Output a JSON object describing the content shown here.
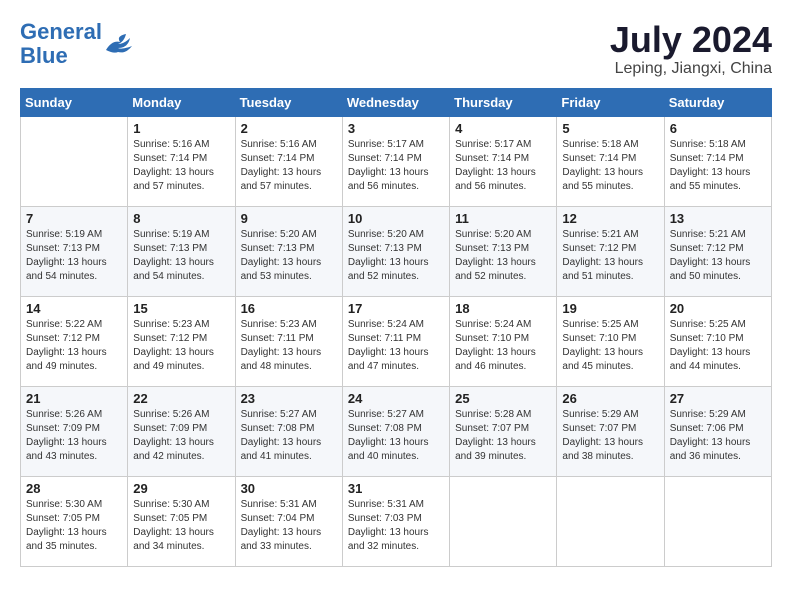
{
  "header": {
    "logo_line1": "General",
    "logo_line2": "Blue",
    "month_year": "July 2024",
    "location": "Leping, Jiangxi, China"
  },
  "weekdays": [
    "Sunday",
    "Monday",
    "Tuesday",
    "Wednesday",
    "Thursday",
    "Friday",
    "Saturday"
  ],
  "weeks": [
    [
      {
        "day": "",
        "info": ""
      },
      {
        "day": "1",
        "info": "Sunrise: 5:16 AM\nSunset: 7:14 PM\nDaylight: 13 hours\nand 57 minutes."
      },
      {
        "day": "2",
        "info": "Sunrise: 5:16 AM\nSunset: 7:14 PM\nDaylight: 13 hours\nand 57 minutes."
      },
      {
        "day": "3",
        "info": "Sunrise: 5:17 AM\nSunset: 7:14 PM\nDaylight: 13 hours\nand 56 minutes."
      },
      {
        "day": "4",
        "info": "Sunrise: 5:17 AM\nSunset: 7:14 PM\nDaylight: 13 hours\nand 56 minutes."
      },
      {
        "day": "5",
        "info": "Sunrise: 5:18 AM\nSunset: 7:14 PM\nDaylight: 13 hours\nand 55 minutes."
      },
      {
        "day": "6",
        "info": "Sunrise: 5:18 AM\nSunset: 7:14 PM\nDaylight: 13 hours\nand 55 minutes."
      }
    ],
    [
      {
        "day": "7",
        "info": "Sunrise: 5:19 AM\nSunset: 7:13 PM\nDaylight: 13 hours\nand 54 minutes."
      },
      {
        "day": "8",
        "info": "Sunrise: 5:19 AM\nSunset: 7:13 PM\nDaylight: 13 hours\nand 54 minutes."
      },
      {
        "day": "9",
        "info": "Sunrise: 5:20 AM\nSunset: 7:13 PM\nDaylight: 13 hours\nand 53 minutes."
      },
      {
        "day": "10",
        "info": "Sunrise: 5:20 AM\nSunset: 7:13 PM\nDaylight: 13 hours\nand 52 minutes."
      },
      {
        "day": "11",
        "info": "Sunrise: 5:20 AM\nSunset: 7:13 PM\nDaylight: 13 hours\nand 52 minutes."
      },
      {
        "day": "12",
        "info": "Sunrise: 5:21 AM\nSunset: 7:12 PM\nDaylight: 13 hours\nand 51 minutes."
      },
      {
        "day": "13",
        "info": "Sunrise: 5:21 AM\nSunset: 7:12 PM\nDaylight: 13 hours\nand 50 minutes."
      }
    ],
    [
      {
        "day": "14",
        "info": "Sunrise: 5:22 AM\nSunset: 7:12 PM\nDaylight: 13 hours\nand 49 minutes."
      },
      {
        "day": "15",
        "info": "Sunrise: 5:23 AM\nSunset: 7:12 PM\nDaylight: 13 hours\nand 49 minutes."
      },
      {
        "day": "16",
        "info": "Sunrise: 5:23 AM\nSunset: 7:11 PM\nDaylight: 13 hours\nand 48 minutes."
      },
      {
        "day": "17",
        "info": "Sunrise: 5:24 AM\nSunset: 7:11 PM\nDaylight: 13 hours\nand 47 minutes."
      },
      {
        "day": "18",
        "info": "Sunrise: 5:24 AM\nSunset: 7:10 PM\nDaylight: 13 hours\nand 46 minutes."
      },
      {
        "day": "19",
        "info": "Sunrise: 5:25 AM\nSunset: 7:10 PM\nDaylight: 13 hours\nand 45 minutes."
      },
      {
        "day": "20",
        "info": "Sunrise: 5:25 AM\nSunset: 7:10 PM\nDaylight: 13 hours\nand 44 minutes."
      }
    ],
    [
      {
        "day": "21",
        "info": "Sunrise: 5:26 AM\nSunset: 7:09 PM\nDaylight: 13 hours\nand 43 minutes."
      },
      {
        "day": "22",
        "info": "Sunrise: 5:26 AM\nSunset: 7:09 PM\nDaylight: 13 hours\nand 42 minutes."
      },
      {
        "day": "23",
        "info": "Sunrise: 5:27 AM\nSunset: 7:08 PM\nDaylight: 13 hours\nand 41 minutes."
      },
      {
        "day": "24",
        "info": "Sunrise: 5:27 AM\nSunset: 7:08 PM\nDaylight: 13 hours\nand 40 minutes."
      },
      {
        "day": "25",
        "info": "Sunrise: 5:28 AM\nSunset: 7:07 PM\nDaylight: 13 hours\nand 39 minutes."
      },
      {
        "day": "26",
        "info": "Sunrise: 5:29 AM\nSunset: 7:07 PM\nDaylight: 13 hours\nand 38 minutes."
      },
      {
        "day": "27",
        "info": "Sunrise: 5:29 AM\nSunset: 7:06 PM\nDaylight: 13 hours\nand 36 minutes."
      }
    ],
    [
      {
        "day": "28",
        "info": "Sunrise: 5:30 AM\nSunset: 7:05 PM\nDaylight: 13 hours\nand 35 minutes."
      },
      {
        "day": "29",
        "info": "Sunrise: 5:30 AM\nSunset: 7:05 PM\nDaylight: 13 hours\nand 34 minutes."
      },
      {
        "day": "30",
        "info": "Sunrise: 5:31 AM\nSunset: 7:04 PM\nDaylight: 13 hours\nand 33 minutes."
      },
      {
        "day": "31",
        "info": "Sunrise: 5:31 AM\nSunset: 7:03 PM\nDaylight: 13 hours\nand 32 minutes."
      },
      {
        "day": "",
        "info": ""
      },
      {
        "day": "",
        "info": ""
      },
      {
        "day": "",
        "info": ""
      }
    ]
  ]
}
